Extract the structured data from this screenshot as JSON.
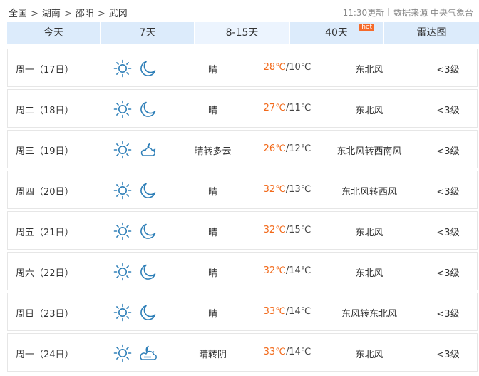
{
  "breadcrumb": [
    "全国",
    "湖南",
    "邵阳",
    "武冈"
  ],
  "meta": {
    "updated": "11:30更新",
    "source": "数据来源 中央气象台"
  },
  "tabs": [
    {
      "label": "今天",
      "active": false
    },
    {
      "label": "7天",
      "active": false
    },
    {
      "label": "8-15天",
      "active": true
    },
    {
      "label": "40天",
      "active": false,
      "badge": "hot"
    },
    {
      "label": "雷达图",
      "active": false
    }
  ],
  "colors": {
    "tab_bg": "#dcebfb",
    "tab_active_bg": "#ecf4fe",
    "high_temp": "#f26a1b",
    "icon": "#2e7fb8",
    "hot_badge": "#f56a2a"
  },
  "days": [
    {
      "day": "周一（17日）",
      "day_icon": "sun-icon",
      "night_icon": "moon-icon",
      "desc": "晴",
      "high": "28℃",
      "low": "/10℃",
      "wind": "东北风",
      "level": "<3级"
    },
    {
      "day": "周二（18日）",
      "day_icon": "sun-icon",
      "night_icon": "moon-icon",
      "desc": "晴",
      "high": "27℃",
      "low": "/11℃",
      "wind": "东北风",
      "level": "<3级"
    },
    {
      "day": "周三（19日）",
      "day_icon": "sun-icon",
      "night_icon": "cloudy-night-icon",
      "desc": "晴转多云",
      "high": "26℃",
      "low": "/12℃",
      "wind": "东北风转西南风",
      "level": "<3级"
    },
    {
      "day": "周四（20日）",
      "day_icon": "sun-icon",
      "night_icon": "moon-icon",
      "desc": "晴",
      "high": "32℃",
      "low": "/13℃",
      "wind": "东北风转西风",
      "level": "<3级"
    },
    {
      "day": "周五（21日）",
      "day_icon": "sun-icon",
      "night_icon": "moon-icon",
      "desc": "晴",
      "high": "32℃",
      "low": "/15℃",
      "wind": "东北风",
      "level": "<3级"
    },
    {
      "day": "周六（22日）",
      "day_icon": "sun-icon",
      "night_icon": "moon-icon",
      "desc": "晴",
      "high": "32℃",
      "low": "/14℃",
      "wind": "东北风",
      "level": "<3级"
    },
    {
      "day": "周日（23日）",
      "day_icon": "sun-icon",
      "night_icon": "moon-icon",
      "desc": "晴",
      "high": "33℃",
      "low": "/14℃",
      "wind": "东风转东北风",
      "level": "<3级"
    },
    {
      "day": "周一（24日）",
      "day_icon": "sun-icon",
      "night_icon": "overcast-night-icon",
      "desc": "晴转阴",
      "high": "33℃",
      "low": "/14℃",
      "wind": "东北风",
      "level": "<3级"
    }
  ]
}
